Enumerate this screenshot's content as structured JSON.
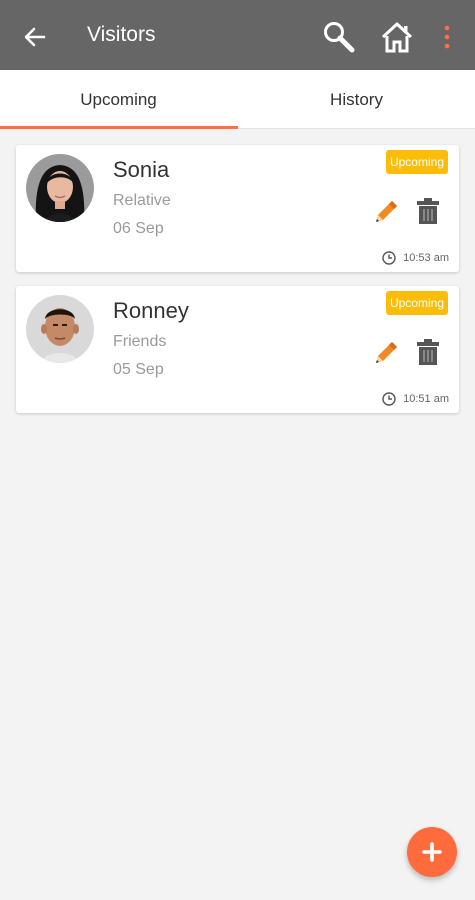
{
  "header": {
    "title": "Visitors",
    "icons": [
      "back-arrow-icon",
      "search-icon",
      "home-icon",
      "more-vertical-icon"
    ],
    "accent_color": "#ff7043"
  },
  "tabs": [
    {
      "label": "Upcoming",
      "selected": true
    },
    {
      "label": "History",
      "selected": false
    }
  ],
  "visitors": [
    {
      "name": "Sonia",
      "relation": "Relative",
      "date": "06 Sep",
      "status": "Upcoming",
      "time": "10:53 am"
    },
    {
      "name": "Ronney",
      "relation": "Friends",
      "date": "05 Sep",
      "status": "Upcoming",
      "time": "10:51 am"
    }
  ],
  "colors": {
    "topbar": "#666666",
    "badge": "#fbbd0a",
    "fab": "#ff6b3d",
    "edit": "#f08a24"
  },
  "fab": {
    "icon": "plus-icon"
  }
}
